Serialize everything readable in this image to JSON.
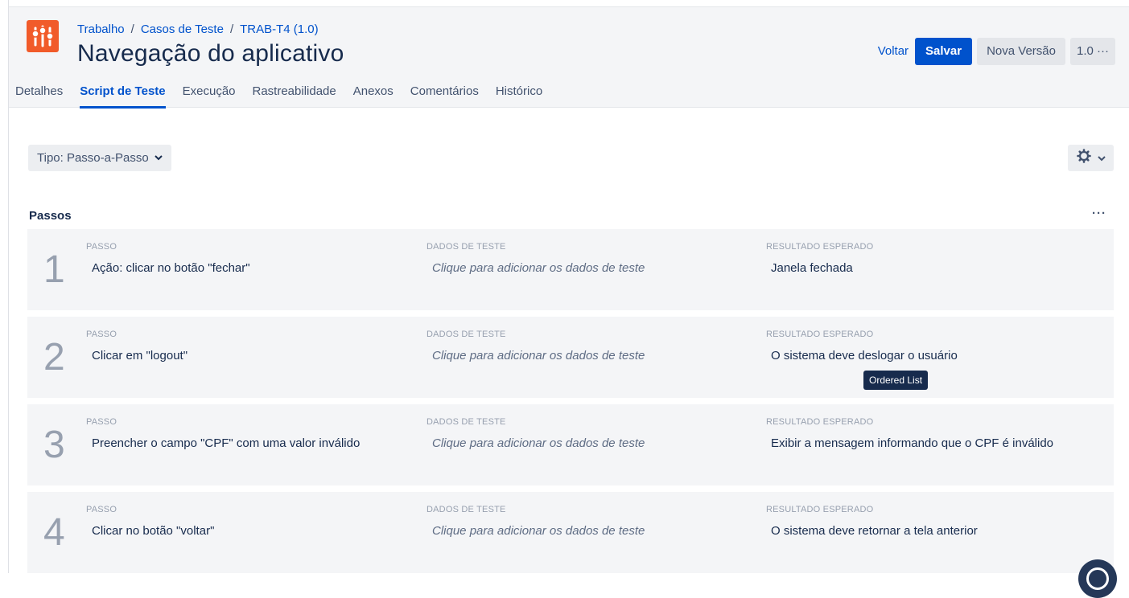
{
  "breadcrumb": [
    "Trabalho",
    "Casos de Teste",
    "TRAB-T4 (1.0)"
  ],
  "breadcrumb_separator": "/",
  "title": "Navegação do aplicativo",
  "actions": {
    "back": "Voltar",
    "save": "Salvar",
    "new_version": "Nova Versão",
    "version": "1.0 ···"
  },
  "tabs": [
    "Detalhes",
    "Script de Teste",
    "Execução",
    "Rastreabilidade",
    "Anexos",
    "Comentários",
    "Histórico"
  ],
  "active_tab": "Script de Teste",
  "type_select": "Tipo: Passo-a-Passo",
  "steps_heading": "Passos",
  "steps_more": "···",
  "column_labels": {
    "step": "PASSO",
    "test_data": "DADOS DE TESTE",
    "expected": "RESULTADO ESPERADO"
  },
  "steps": [
    {
      "number": "1",
      "step": "Ação: clicar no botão \"fechar\"",
      "test_data": "Clique para adicionar os dados de teste",
      "expected": "Janela fechada"
    },
    {
      "number": "2",
      "step": "Clicar em \"logout\"",
      "test_data": "Clique para adicionar os dados de teste",
      "expected": "O sistema deve deslogar o usuário"
    },
    {
      "number": "3",
      "step": "Preencher o campo \"CPF\" com uma valor inválido",
      "test_data": "Clique para adicionar os dados de teste",
      "expected": "Exibir a mensagem informando que o CPF é inválido"
    },
    {
      "number": "4",
      "step": "Clicar no botão \"voltar\"",
      "test_data": "Clique para adicionar os dados de teste",
      "expected": "O sistema deve retornar a tela anterior"
    }
  ],
  "tooltip": "Ordered List",
  "colors": {
    "accent": "#0052cc",
    "app_icon": "#f15b2a",
    "step_bg": "#f4f5f7"
  },
  "icons": [
    "sliders-icon",
    "chevron-down-icon",
    "gear-icon",
    "help-icon"
  ]
}
